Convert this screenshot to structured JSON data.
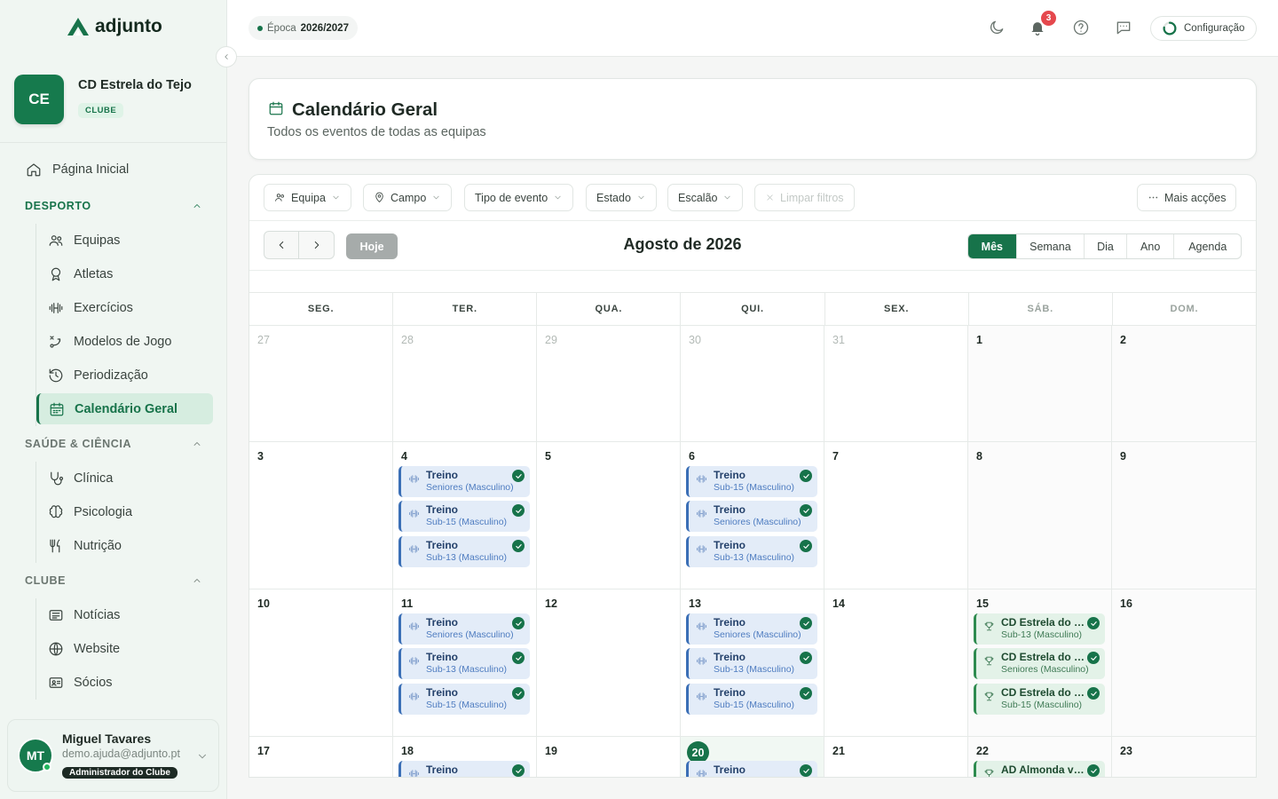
{
  "brand": {
    "name": "adjunto"
  },
  "club": {
    "initials": "CE",
    "name": "CD Estrela do Tejo",
    "badge": "CLUBE"
  },
  "nav": {
    "home": "Página Inicial",
    "sections": [
      {
        "title": "DESPORTO",
        "items": [
          "Equipas",
          "Atletas",
          "Exercícios",
          "Modelos de Jogo",
          "Periodização",
          "Calendário Geral"
        ]
      },
      {
        "title": "SAÚDE & CIÊNCIA",
        "items": [
          "Clínica",
          "Psicologia",
          "Nutrição"
        ]
      },
      {
        "title": "CLUBE",
        "items": [
          "Notícias",
          "Website",
          "Sócios"
        ]
      }
    ]
  },
  "user": {
    "initials": "MT",
    "name": "Miguel Tavares",
    "email": "demo.ajuda@adjunto.pt",
    "role": "Administrador do Clube"
  },
  "topbar": {
    "season_label": "Época",
    "season_value": "2026/2027",
    "notifications": "3",
    "config": "Configuração"
  },
  "page": {
    "title": "Calendário Geral",
    "subtitle": "Todos os eventos de todas as equipas"
  },
  "filters": {
    "team": "Equipa",
    "field": "Campo",
    "event_type": "Tipo de evento",
    "status": "Estado",
    "age_group": "Escalão",
    "clear": "Limpar filtros",
    "more": "Mais acções"
  },
  "calendar": {
    "today_button": "Hoje",
    "month_title": "Agosto de 2026",
    "views": [
      "Mês",
      "Semana",
      "Dia",
      "Ano",
      "Agenda"
    ],
    "active_view": "Mês",
    "weekdays": [
      "SEG.",
      "TER.",
      "QUA.",
      "QUI.",
      "SEX.",
      "SÁB.",
      "DOM."
    ],
    "weeks": [
      [
        {
          "d": "27",
          "other": true
        },
        {
          "d": "28",
          "other": true
        },
        {
          "d": "29",
          "other": true
        },
        {
          "d": "30",
          "other": true
        },
        {
          "d": "31",
          "other": true
        },
        {
          "d": "1"
        },
        {
          "d": "2"
        }
      ],
      [
        {
          "d": "3"
        },
        {
          "d": "4",
          "events": [
            {
              "title": "Treino",
              "sub": "Seniores (Masculino)"
            },
            {
              "title": "Treino",
              "sub": "Sub-15 (Masculino)"
            },
            {
              "title": "Treino",
              "sub": "Sub-13 (Masculino)"
            }
          ]
        },
        {
          "d": "5"
        },
        {
          "d": "6",
          "events": [
            {
              "title": "Treino",
              "sub": "Sub-15 (Masculino)"
            },
            {
              "title": "Treino",
              "sub": "Seniores (Masculino)"
            },
            {
              "title": "Treino",
              "sub": "Sub-13 (Masculino)"
            }
          ]
        },
        {
          "d": "7"
        },
        {
          "d": "8"
        },
        {
          "d": "9"
        }
      ],
      [
        {
          "d": "10"
        },
        {
          "d": "11",
          "events": [
            {
              "title": "Treino",
              "sub": "Seniores (Masculino)"
            },
            {
              "title": "Treino",
              "sub": "Sub-13 (Masculino)"
            },
            {
              "title": "Treino",
              "sub": "Sub-15 (Masculino)"
            }
          ]
        },
        {
          "d": "12"
        },
        {
          "d": "13",
          "events": [
            {
              "title": "Treino",
              "sub": "Seniores (Masculino)"
            },
            {
              "title": "Treino",
              "sub": "Sub-13 (Masculino)"
            },
            {
              "title": "Treino",
              "sub": "Sub-15 (Masculino)"
            }
          ]
        },
        {
          "d": "14"
        },
        {
          "d": "15",
          "events": [
            {
              "title": "CD Estrela do T...",
              "sub": "Sub-13 (Masculino)",
              "match": true
            },
            {
              "title": "CD Estrela do T...",
              "sub": "Seniores (Masculino)",
              "match": true
            },
            {
              "title": "CD Estrela do T...",
              "sub": "Sub-15 (Masculino)",
              "match": true
            }
          ]
        },
        {
          "d": "16"
        }
      ],
      [
        {
          "d": "17"
        },
        {
          "d": "18",
          "events": [
            {
              "title": "Treino",
              "sub": ""
            }
          ]
        },
        {
          "d": "19"
        },
        {
          "d": "20",
          "today": true,
          "events": [
            {
              "title": "Treino",
              "sub": ""
            }
          ]
        },
        {
          "d": "21"
        },
        {
          "d": "22",
          "events": [
            {
              "title": "AD Almonda vs C...",
              "sub": "",
              "match": true
            }
          ]
        },
        {
          "d": "23"
        }
      ]
    ]
  },
  "colors": {
    "accent": "#17734a",
    "training": "#3b6fb6",
    "match": "#2e8b4f"
  }
}
